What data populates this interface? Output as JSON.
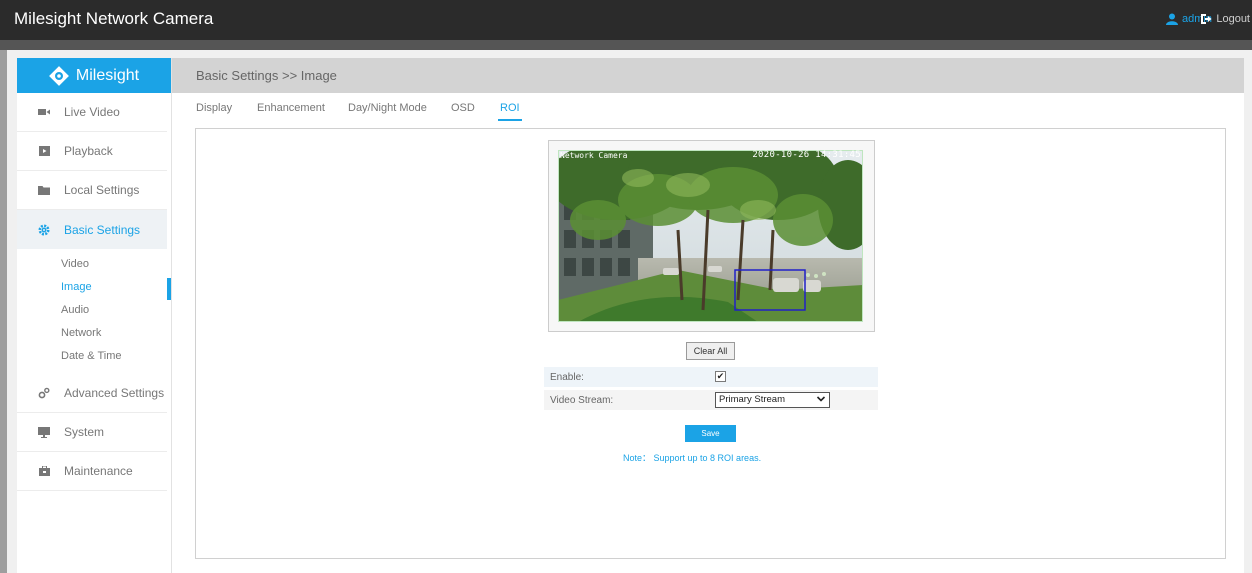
{
  "header": {
    "app_title": "Milesight Network Camera",
    "user": "admin",
    "logout": "Logout"
  },
  "sidebar": {
    "logo_text": "Milesight",
    "items": [
      {
        "label": "Live Video",
        "icon": "video-camera-icon"
      },
      {
        "label": "Playback",
        "icon": "playback-icon"
      },
      {
        "label": "Local Settings",
        "icon": "folder-icon"
      },
      {
        "label": "Basic Settings",
        "icon": "gear-icon",
        "active": true
      },
      {
        "label": "Advanced Settings",
        "icon": "gears-icon"
      },
      {
        "label": "System",
        "icon": "monitor-icon"
      },
      {
        "label": "Maintenance",
        "icon": "toolbox-icon"
      }
    ],
    "sub_items": [
      {
        "label": "Video"
      },
      {
        "label": "Image",
        "active": true
      },
      {
        "label": "Audio"
      },
      {
        "label": "Network"
      },
      {
        "label": "Date & Time"
      }
    ]
  },
  "breadcrumb": "Basic Settings >> Image",
  "tabs": [
    {
      "label": "Display"
    },
    {
      "label": "Enhancement"
    },
    {
      "label": "Day/Night Mode"
    },
    {
      "label": "OSD"
    },
    {
      "label": "ROI",
      "active": true
    }
  ],
  "roi": {
    "osd_name": "Network Camera",
    "osd_datetime": "2020-10-26 14:31:45",
    "clear_all": "Clear All",
    "enable_label": "Enable:",
    "enable_checked": true,
    "stream_label": "Video Stream:",
    "stream_value": "Primary Stream",
    "save": "Save",
    "note": "Note： Support up to 8 ROI areas."
  },
  "colors": {
    "accent": "#1ba3e6",
    "topbar": "#2b2b2b",
    "roi_box": "#2020c8"
  }
}
